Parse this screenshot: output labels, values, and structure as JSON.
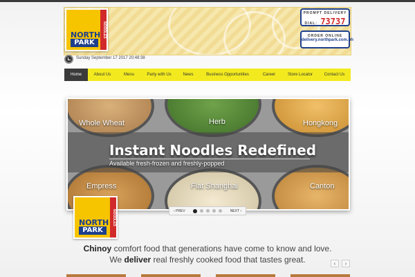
{
  "header": {
    "logo": {
      "line1": "NORTH",
      "line2": "PARK",
      "side": "NOODLES"
    },
    "delivery_badge": {
      "label": "PROMPT DELIVERY",
      "dial_label": "DIAL:",
      "number": "73737"
    },
    "online_badge": {
      "label": "ORDER ONLINE",
      "url": "delivery.northpark.com.ph"
    }
  },
  "datetime": "Sunday September 17 2017 20:48:38",
  "nav": {
    "items": [
      {
        "label": "Home",
        "active": true
      },
      {
        "label": "About Us"
      },
      {
        "label": "Menu"
      },
      {
        "label": "Party with Us"
      },
      {
        "label": "News"
      },
      {
        "label": "Business Opportunities"
      },
      {
        "label": "Career"
      },
      {
        "label": "Store Locator"
      },
      {
        "label": "Contact Us"
      }
    ]
  },
  "slider": {
    "title": "Instant Noodles Redefined",
    "subtitle": "Available fresh-frozen and freshly-popped",
    "noodles": [
      "Whole Wheat",
      "Herb",
      "Hongkong",
      "Empress",
      "Flat Shanghai",
      "Canton"
    ],
    "prev_label": "PREV",
    "next_label": "NEXT",
    "page_count": 5,
    "active_page": 1
  },
  "tagline": {
    "line1_bold": "Chinoy",
    "line1_rest": " comfort food that generations have come to know and love.",
    "line2_start": "We ",
    "line2_bold": "deliver",
    "line2_rest": " real freshly cooked food that tastes great."
  },
  "colors": {
    "brand_yellow": "#f7c400",
    "brand_blue": "#1d3f8c",
    "nav_yellow": "#f2ea1f",
    "accent_red": "#d12a2a"
  }
}
